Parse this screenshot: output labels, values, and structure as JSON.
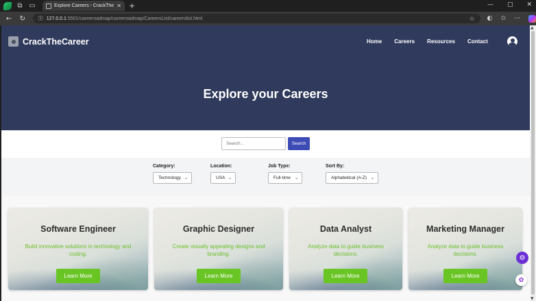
{
  "browser": {
    "tab_title": "Explore Careers - CrackTheCareer",
    "url_host": "127.0.0.1",
    "url_path": ":5501/careeroadmap/careeroadmap/CareersList/careerslist.html"
  },
  "header": {
    "brand": "CrackTheCareer",
    "nav": [
      "Home",
      "Careers",
      "Resources",
      "Contact"
    ]
  },
  "hero": {
    "title": "Explore your Careers"
  },
  "search": {
    "placeholder": "Search...",
    "button": "Search"
  },
  "filters": [
    {
      "label": "Category:",
      "value": "Technology"
    },
    {
      "label": "Location:",
      "value": "USA"
    },
    {
      "label": "Job Type:",
      "value": "Full-time"
    },
    {
      "label": "Sort By:",
      "value": "Alphabetical (A-Z)"
    }
  ],
  "cards": [
    {
      "title": "Software Engineer",
      "desc": "Build innovative solutions in technology and coding.",
      "button": "Learn More"
    },
    {
      "title": "Graphic Designer",
      "desc": "Create visually appealing designs and branding.",
      "button": "Learn More"
    },
    {
      "title": "Data Analyst",
      "desc": "Analyze data to guide business decisions.",
      "button": "Learn More"
    },
    {
      "title": "Marketing Manager",
      "desc": "Analyze data to guide business decisions.",
      "button": "Learn More"
    }
  ],
  "colors": {
    "hero_bg": "#2f3a5c",
    "accent_green": "#69c524",
    "search_button": "#3d4bb5"
  }
}
